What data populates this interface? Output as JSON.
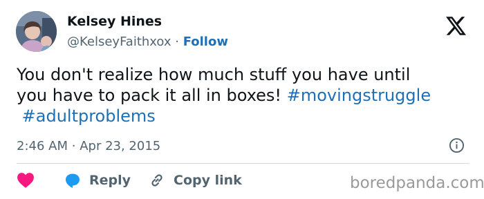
{
  "author": {
    "name": "Kelsey Hines",
    "handle": "@KelseyFaithxox",
    "separator": "·",
    "follow_label": "Follow"
  },
  "tweet": {
    "text_line1": "You don't realize how much stuff you have until",
    "text_line2": "you have to pack it all in boxes!",
    "hashtag1": "#movingstruggle",
    "hashtag2": "#adultproblems"
  },
  "meta": {
    "time": "2:46 AM",
    "separator": "·",
    "date": "Apr 23, 2015"
  },
  "actions": {
    "reply_label": "Reply",
    "copy_label": "Copy link"
  },
  "watermark": "boredpanda.com",
  "icons": {
    "brand": "x-logo-icon",
    "info": "info-icon",
    "like": "heart-icon",
    "reply": "reply-bubble-icon",
    "copy": "link-icon"
  },
  "colors": {
    "link": "#1d70b8",
    "heart": "#f91880",
    "reply": "#1d9bf0",
    "muted": "#536471",
    "text": "#0f1419"
  }
}
